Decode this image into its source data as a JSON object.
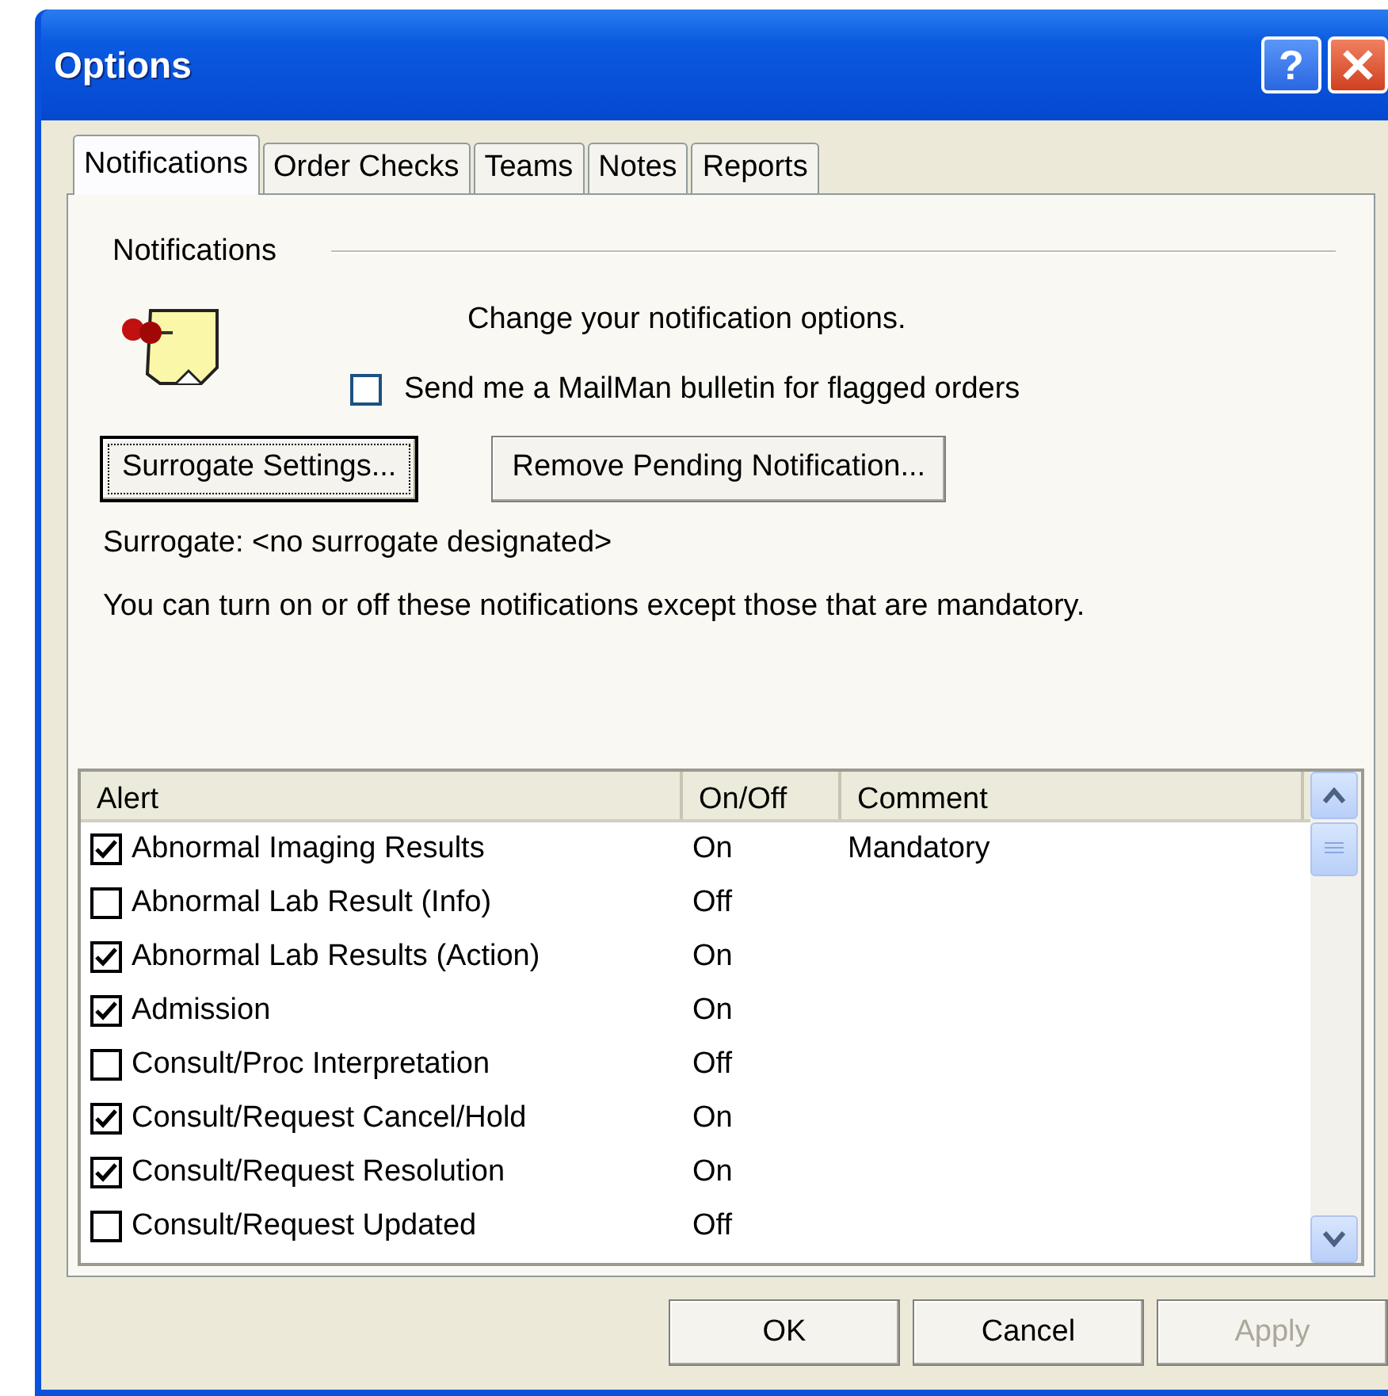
{
  "window": {
    "title": "Options",
    "help_button": "?"
  },
  "tabs": [
    {
      "label": "Notifications",
      "selected": true
    },
    {
      "label": "Order Checks",
      "selected": false
    },
    {
      "label": "Teams",
      "selected": false
    },
    {
      "label": "Notes",
      "selected": false
    },
    {
      "label": "Reports",
      "selected": false
    }
  ],
  "group_title": "Notifications",
  "intro": "Change your notification options.",
  "mailman_checkbox": {
    "label": "Send me a MailMan bulletin for flagged orders",
    "checked": false
  },
  "buttons_top": [
    {
      "label": "Surrogate Settings...",
      "focused": true
    },
    {
      "label": "Remove Pending Notification...",
      "focused": false
    }
  ],
  "surrogate_text": "Surrogate: <no surrogate designated>",
  "info_text": "You can turn on or off these notifications except those that are mandatory.",
  "table": {
    "columns": [
      "Alert",
      "On/Off",
      "Comment"
    ],
    "rows": [
      {
        "checked": true,
        "alert": "Abnormal Imaging Results",
        "on_off": "On",
        "comment": "Mandatory"
      },
      {
        "checked": false,
        "alert": "Abnormal Lab Result (Info)",
        "on_off": "Off",
        "comment": ""
      },
      {
        "checked": true,
        "alert": "Abnormal Lab Results (Action)",
        "on_off": "On",
        "comment": ""
      },
      {
        "checked": true,
        "alert": "Admission",
        "on_off": "On",
        "comment": ""
      },
      {
        "checked": false,
        "alert": "Consult/Proc Interpretation",
        "on_off": "Off",
        "comment": ""
      },
      {
        "checked": true,
        "alert": "Consult/Request Cancel/Hold",
        "on_off": "On",
        "comment": ""
      },
      {
        "checked": true,
        "alert": "Consult/Request Resolution",
        "on_off": "On",
        "comment": ""
      },
      {
        "checked": false,
        "alert": "Consult/Request Updated",
        "on_off": "Off",
        "comment": ""
      }
    ]
  },
  "buttons_bottom": [
    {
      "label": "OK",
      "disabled": false
    },
    {
      "label": "Cancel",
      "disabled": false
    },
    {
      "label": "Apply",
      "disabled": true
    }
  ]
}
